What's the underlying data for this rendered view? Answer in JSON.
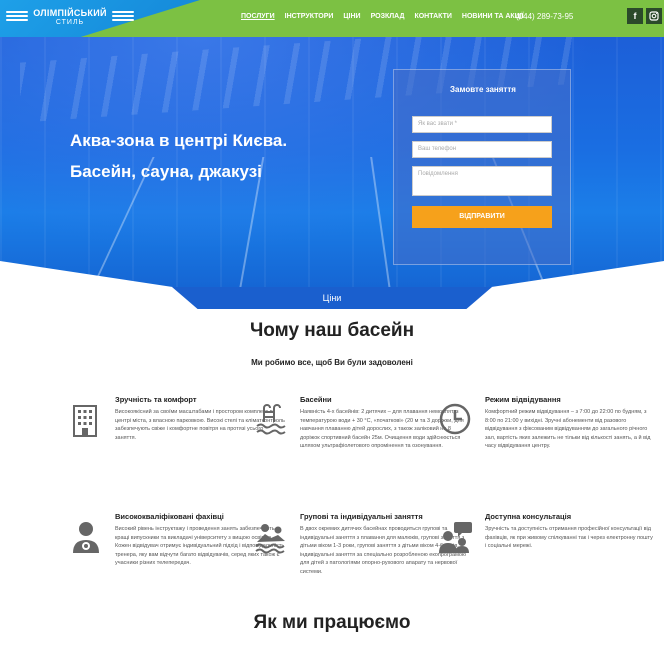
{
  "header": {
    "logo_title": "ОЛІМПІЙСЬКИЙ",
    "logo_subtitle": "СТИЛЬ",
    "nav": [
      "ПОСЛУГИ",
      "ІНСТРУКТОРИ",
      "ЦІНИ",
      "РОЗКЛАД",
      "КОНТАКТИ",
      "НОВИНИ ТА АКЦІЇ"
    ],
    "active_nav": "ПОСЛУГИ",
    "phone": "(044) 289-73-95",
    "social": [
      "facebook-icon",
      "instagram-icon"
    ],
    "colors": {
      "bar": "#7cc143",
      "logo_wedge": "#1384d6"
    }
  },
  "hero": {
    "title_line1": "Аква-зона в центрі Києва.",
    "title_line2": "Басейн, сауна, джакузі",
    "form": {
      "title": "Замовте заняття",
      "name_placeholder": "Як вас звати *",
      "phone_placeholder": "Ваш телефон",
      "message_placeholder": "Повідомлення",
      "submit_label": "ВІДПРАВИТИ",
      "submit_color": "#f6a11b"
    },
    "tab_label": "Ціни"
  },
  "why": {
    "title": "Чому наш басейн",
    "subtitle": "Ми робимо все, щоб Ви були задоволені",
    "features": [
      {
        "icon": "building-icon",
        "title": "Зручність та комфорт",
        "text": "Високоякісний за своїми масштабами і простором комплекс в центрі міста, з власною парковкою. Високі стелі та кліматконтроль забезпечують свіже і комфортне повітря на протязі усього заняття."
      },
      {
        "icon": "pool-ladder-icon",
        "title": "Басейни",
        "text": "Наявність 4-х басейнів: 2 дитячих – для плавання немовлят, з температурою води + 30 °С, «початкові» (20 м та 3 доріжки, для навчання плаванню дітей дорослих, з також заліковий на 8 доріжок спортивний басейн 25м. Очищення води здійснюється шляхом ультрафіолетового опромінення та озонування."
      },
      {
        "icon": "clock-icon",
        "title": "Режим відвідування",
        "text": "Комфортний режим відвідування – з 7:00 до 22:00 по будням, з 8:00 по 21:00 у вихідні. Зручні абонементи від разового відвідування з фіксованим відвідуванням до загального річного зал, вартість яких залежить не тільки від кількості занять, а й від часу відвідування центру."
      },
      {
        "icon": "instructor-icon",
        "title": "Висококваліфіковані фахівці",
        "text": "Високий рівень інструктажу і проведення занять забезпечують кращі випускники та викладачі університету з вищою освітою. Кожен відвідувач отримує індивідуальний підхід і відповідальність тренера, яку вам відчути багато відвідувачів, серед яких також є учасники різних телепередач."
      },
      {
        "icon": "swimmers-icon",
        "title": "Групові та індивідуальні заняття",
        "text": "В двох окремих дитячих басейнах проводиться групові та індивідуальні заняття з плавання для малюків, групові заняття з дітьми віком 1-3 роки, групові заняття з дітьми віком 4-6 років, індивідуальні заняття за спеціально розробленою екопрограмою для дітей з патологіями опорно-рухового апарату та нервової системи."
      },
      {
        "icon": "consultation-icon",
        "title": "Доступна консультація",
        "text": "Зручність та доступність отримання професійної консультації від фахівців, як при живому спілкуванні так і через електронну пошту і соціальні мережі."
      }
    ]
  },
  "how": {
    "title": "Як ми працюємо"
  }
}
